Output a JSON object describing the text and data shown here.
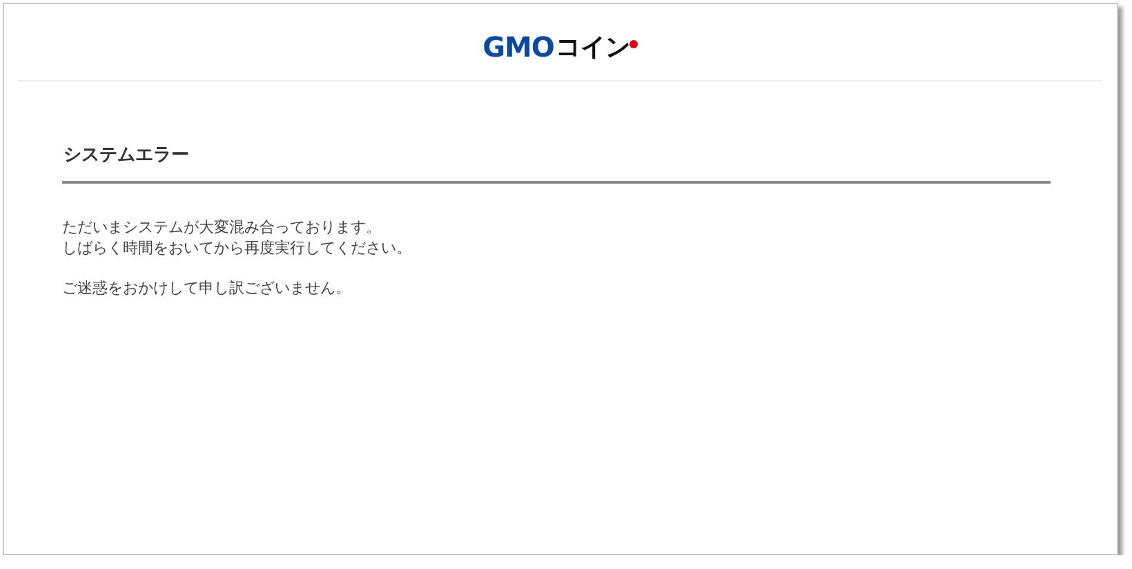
{
  "header": {
    "logo": {
      "mark": "GMO",
      "name": "コイン"
    }
  },
  "error": {
    "title": "システムエラー",
    "paragraphs": [
      [
        "ただいまシステムが大変混み合っております。",
        "しばらく時間をおいてから再度実行してください。"
      ],
      [
        "ご迷惑をおかけして申し訳ございません。"
      ]
    ]
  }
}
